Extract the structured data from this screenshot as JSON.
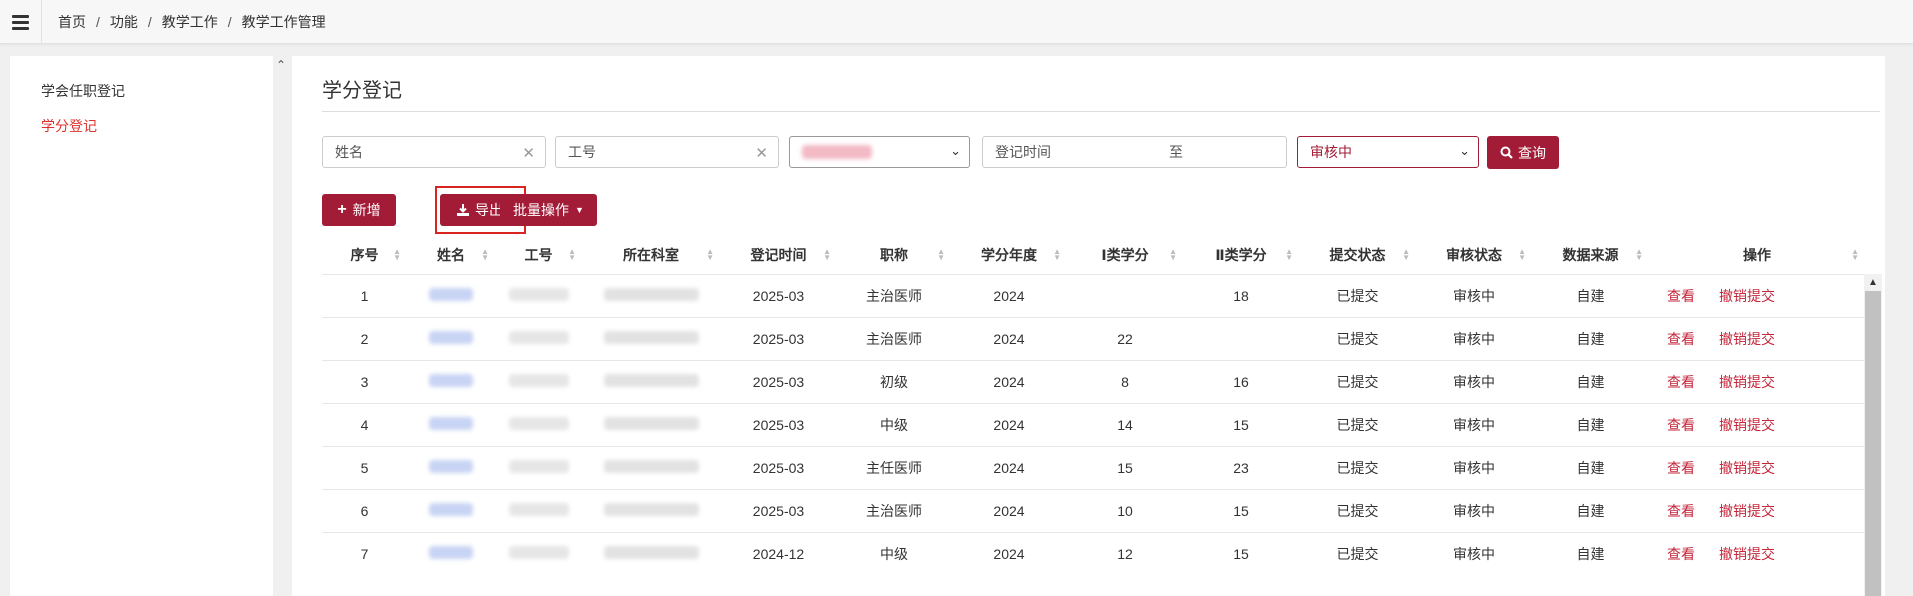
{
  "breadcrumb": [
    "首页",
    "功能",
    "教学工作",
    "教学工作管理"
  ],
  "sidebar": {
    "items": [
      {
        "label": "学会任职登记",
        "active": false
      },
      {
        "label": "学分登记",
        "active": true
      }
    ]
  },
  "page": {
    "title": "学分登记"
  },
  "filters": {
    "name_placeholder": "姓名",
    "id_placeholder": "工号",
    "date_label": "登记时间",
    "date_to": "至",
    "status_selected": "审核中",
    "query_label": "查询"
  },
  "toolbar": {
    "add_label": "新增",
    "export_label": "导出",
    "batch_label": "批量操作"
  },
  "table": {
    "columns": [
      "序号",
      "姓名",
      "工号",
      "所在科室",
      "登记时间",
      "职称",
      "学分年度",
      "Ⅰ类学分",
      "Ⅱ类学分",
      "提交状态",
      "审核状态",
      "数据来源",
      "操作"
    ],
    "rows": [
      {
        "no": "1",
        "date": "2025-03",
        "title": "主治医师",
        "year": "2024",
        "c1": "",
        "c2": "18",
        "submit": "已提交",
        "audit": "审核中",
        "source": "自建"
      },
      {
        "no": "2",
        "date": "2025-03",
        "title": "主治医师",
        "year": "2024",
        "c1": "22",
        "c2": "",
        "submit": "已提交",
        "audit": "审核中",
        "source": "自建"
      },
      {
        "no": "3",
        "date": "2025-03",
        "title": "初级",
        "year": "2024",
        "c1": "8",
        "c2": "16",
        "submit": "已提交",
        "audit": "审核中",
        "source": "自建"
      },
      {
        "no": "4",
        "date": "2025-03",
        "title": "中级",
        "year": "2024",
        "c1": "14",
        "c2": "15",
        "submit": "已提交",
        "audit": "审核中",
        "source": "自建"
      },
      {
        "no": "5",
        "date": "2025-03",
        "title": "主任医师",
        "year": "2024",
        "c1": "15",
        "c2": "23",
        "submit": "已提交",
        "audit": "审核中",
        "source": "自建"
      },
      {
        "no": "6",
        "date": "2025-03",
        "title": "主治医师",
        "year": "2024",
        "c1": "10",
        "c2": "15",
        "submit": "已提交",
        "audit": "审核中",
        "source": "自建"
      },
      {
        "no": "7",
        "date": "2024-12",
        "title": "中级",
        "year": "2024",
        "c1": "12",
        "c2": "15",
        "submit": "已提交",
        "audit": "审核中",
        "source": "自建"
      }
    ],
    "view_label": "查看",
    "revoke_label": "撤销提交"
  },
  "colors": {
    "accent": "#a31c37",
    "link": "#c4263a",
    "active_menu": "#e0322d",
    "highlight_border": "#d9241f"
  }
}
